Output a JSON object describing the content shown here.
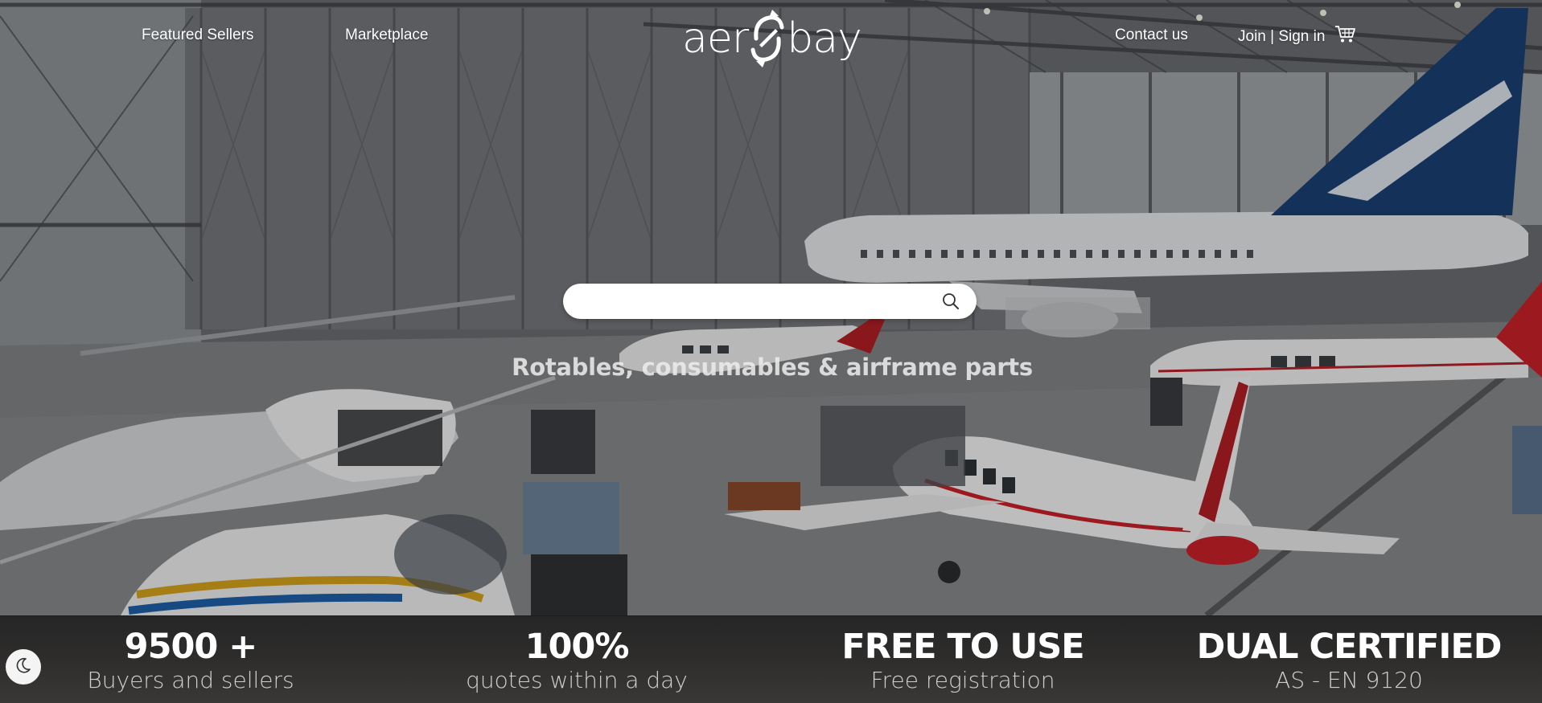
{
  "nav": {
    "featured_sellers": "Featured Sellers",
    "marketplace": "Marketplace",
    "contact": "Contact us",
    "auth": "Join | Sign in"
  },
  "logo": {
    "left": "aer",
    "right": "bay"
  },
  "search": {
    "placeholder": "",
    "value": ""
  },
  "tagline": "Rotables, consumables & airframe parts",
  "stats": [
    {
      "value": "9500 +",
      "label": "Buyers and sellers"
    },
    {
      "value": "100%",
      "label": "quotes within a day"
    },
    {
      "value": "FREE TO USE",
      "label": "Free registration"
    },
    {
      "value": "DUAL CERTIFIED",
      "label": "AS - EN 9120"
    }
  ],
  "icons": {
    "cart": "cart-icon",
    "search": "search-icon",
    "theme": "moon-icon",
    "logo_mark": "plane-swirl-icon"
  },
  "colors": {
    "tail_blue": "#1a3f73",
    "stripe_red": "#c8202a",
    "band_bg": "#2a2a2a"
  }
}
